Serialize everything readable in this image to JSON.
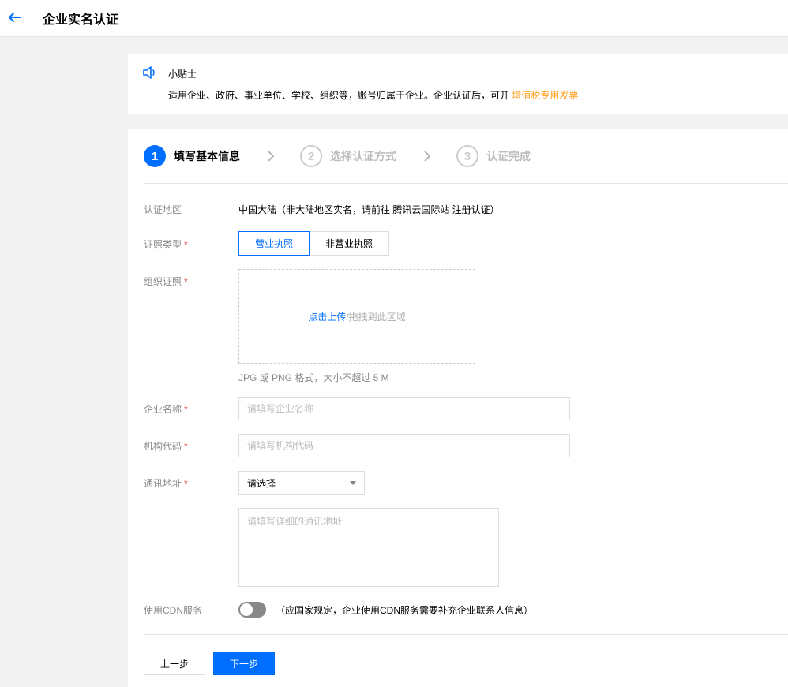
{
  "header": {
    "title": "企业实名认证"
  },
  "tips": {
    "title": "小贴士",
    "text": "适用企业、政府、事业单位、学校、组织等，账号归属于企业。企业认证后，可开 ",
    "link": "增值税专用发票"
  },
  "steps": [
    {
      "num": "1",
      "label": "填写基本信息",
      "state": "active"
    },
    {
      "num": "2",
      "label": "选择认证方式",
      "state": "inactive"
    },
    {
      "num": "3",
      "label": "认证完成",
      "state": "inactive"
    }
  ],
  "form": {
    "region": {
      "label": "认证地区",
      "value": "中国大陆（非大陆地区实名，请前往 腾讯云国际站 注册认证）"
    },
    "license_type": {
      "label": "证照类型",
      "options": [
        "营业执照",
        "非营业执照"
      ],
      "selected": "营业执照"
    },
    "org_license": {
      "label": "组织证照",
      "upload_link": "点击上传",
      "upload_rest": "/拖拽到此区域",
      "hint": "JPG 或 PNG 格式，大小不超过 5 M"
    },
    "company_name": {
      "label": "企业名称",
      "placeholder": "请填写企业名称"
    },
    "org_code": {
      "label": "机构代码",
      "placeholder": "请填写机构代码"
    },
    "address": {
      "label": "通讯地址",
      "select_value": "请选择",
      "detail_placeholder": "请填写详细的通讯地址"
    },
    "cdn": {
      "label": "使用CDN服务",
      "enabled": false,
      "note": "（应国家规定，企业使用CDN服务需要补充企业联系人信息）"
    },
    "required_mark": "*"
  },
  "actions": {
    "prev": "上一步",
    "next": "下一步"
  },
  "colors": {
    "primary": "#006eff",
    "link_orange": "#ff9c19",
    "required_red": "#e54545"
  }
}
